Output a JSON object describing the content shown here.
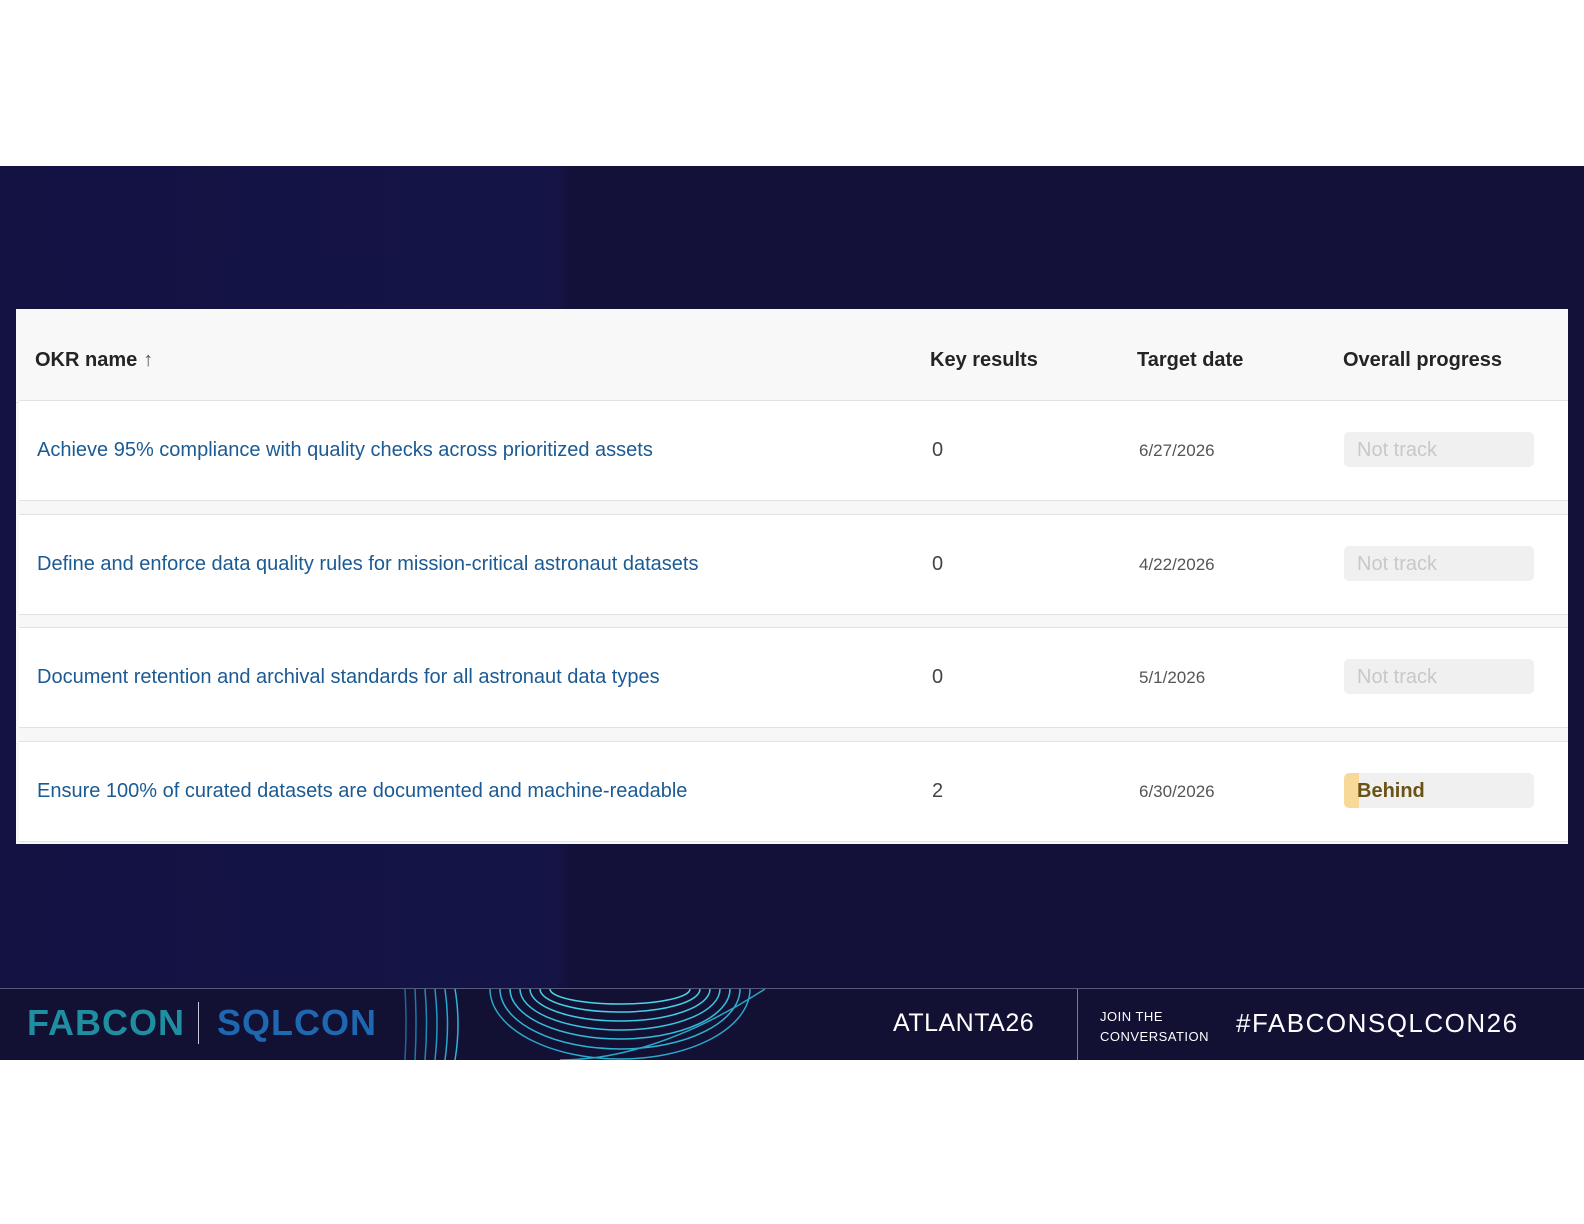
{
  "table": {
    "columns": {
      "name": "OKR name",
      "sort_indicator": "↑",
      "key_results": "Key results",
      "target_date": "Target date",
      "progress": "Overall progress"
    },
    "rows": [
      {
        "name": "Achieve 95% compliance with quality checks across prioritized assets",
        "key_results": "0",
        "target_date": "6/27/2026",
        "progress_label": "Not track"
      },
      {
        "name": "Define and enforce data quality rules for mission-critical astronaut datasets",
        "key_results": "0",
        "target_date": "4/22/2026",
        "progress_label": "Not track"
      },
      {
        "name": "Document retention and archival standards for all astronaut data types",
        "key_results": "0",
        "target_date": "5/1/2026",
        "progress_label": "Not track"
      },
      {
        "name": "Ensure 100% of curated datasets are documented and machine-readable",
        "key_results": "2",
        "target_date": "6/30/2026",
        "progress_label": "Behind",
        "progress_status_color": "#f8d99a"
      }
    ]
  },
  "footer": {
    "logo_left": "FABCON",
    "logo_right": "SQLCON",
    "location": "ATLANTA26",
    "join_line1": "JOIN THE",
    "join_line2": "CONVERSATION",
    "hashtag": "#FABCONSQLCON26"
  },
  "colors": {
    "slide_background": "#13113a",
    "link": "#1b5a93",
    "fabcon_logo": "#1e8ea0",
    "sqlcon_logo": "#1e67b1"
  }
}
